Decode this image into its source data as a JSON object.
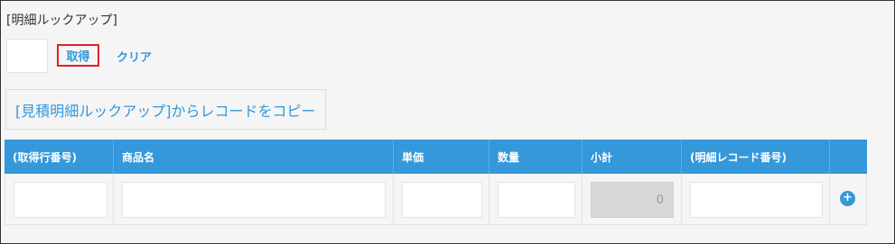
{
  "lookup": {
    "label": "[明細ルックアップ]",
    "value": "",
    "get_label": "取得",
    "clear_label": "クリア"
  },
  "copy_button": {
    "label": "[見積明細ルックアップ]からレコードをコピー"
  },
  "table": {
    "columns": [
      "(取得行番号)",
      "商品名",
      "単価",
      "数量",
      "小計",
      "(明細レコード番号)"
    ],
    "rows": [
      {
        "fetch_row_no": "",
        "product_name": "",
        "unit_price": "",
        "quantity": "",
        "subtotal": "0",
        "detail_record_no": ""
      }
    ],
    "add_row_icon": "plus-circle-icon"
  },
  "colors": {
    "accent": "#3498db",
    "highlight_border": "#e0202a",
    "readonly_bg": "#d8d8d8"
  }
}
